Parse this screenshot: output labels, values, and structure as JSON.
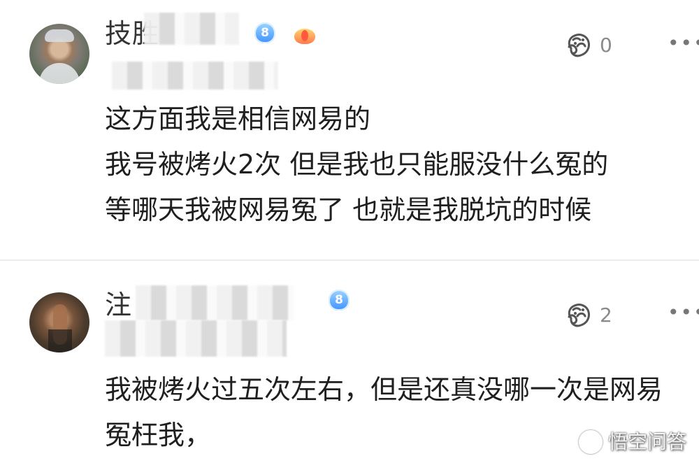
{
  "comments": [
    {
      "username": "技胜",
      "level": "8",
      "likes": "0",
      "lines": [
        "这方面我是相信网易的",
        "我号被烤火2次 但是我也只能服没什么冤的",
        "等哪天我被网易冤了 也就是我脱坑的时候"
      ],
      "icons": {
        "avatar": "user-avatar",
        "level": "level-badge-icon",
        "medal": "medal-icon",
        "like": "like-icon",
        "more": "more-options-icon"
      }
    },
    {
      "username": "注",
      "level": "8",
      "likes": "2",
      "lines": [
        "我被烤火过五次左右，但是还真没哪一次是网易",
        "冤枉我，"
      ],
      "icons": {
        "avatar": "user-avatar",
        "level": "level-badge-icon",
        "like": "like-icon",
        "more": "more-options-icon"
      }
    }
  ],
  "watermark": {
    "text": "悟空问答",
    "icon": "wukong-logo-icon"
  },
  "colors": {
    "text": "#1f1f1f",
    "muted": "#8a8a8a",
    "level_badge": "#3e91ff",
    "divider": "#ececec"
  }
}
